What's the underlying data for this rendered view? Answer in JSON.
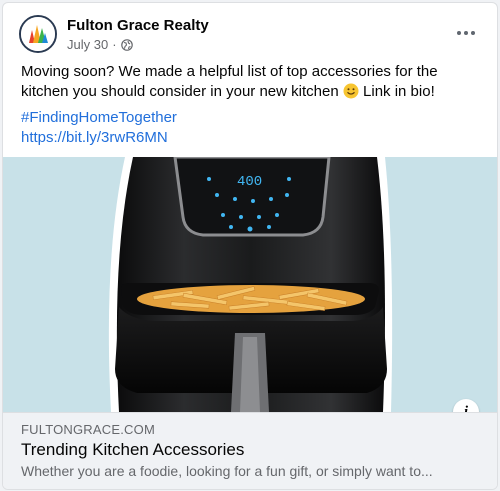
{
  "post": {
    "page_name": "Fulton Grace Realty",
    "date": "July 30",
    "separator": "·",
    "privacy_icon": "globe-icon",
    "more_icon": "more-options-icon",
    "caption_line1": "Moving soon? We made a helpful list of top accessories for the",
    "caption_line2_before_emoji": "kitchen you should consider in your new kitchen ",
    "emoji": "smiley-emoji",
    "caption_line2_after_emoji": " Link in bio!",
    "hashtag": "#FindingHomeTogether",
    "url": "https://bit.ly/3rwR6MN"
  },
  "media": {
    "subject": "air-fryer-image",
    "display_value": "400",
    "background_color": "#c8e1e8"
  },
  "link_preview": {
    "domain": "FULTONGRACE.COM",
    "title": "Trending Kitchen Accessories",
    "description": "Whether you are a foodie, looking for a fun gift, or simply want to...",
    "info_icon": "info-icon",
    "info_label": "i"
  },
  "colors": {
    "link": "#216fdb",
    "secondary_text": "#65676b",
    "preview_bg": "#f0f2f5"
  }
}
